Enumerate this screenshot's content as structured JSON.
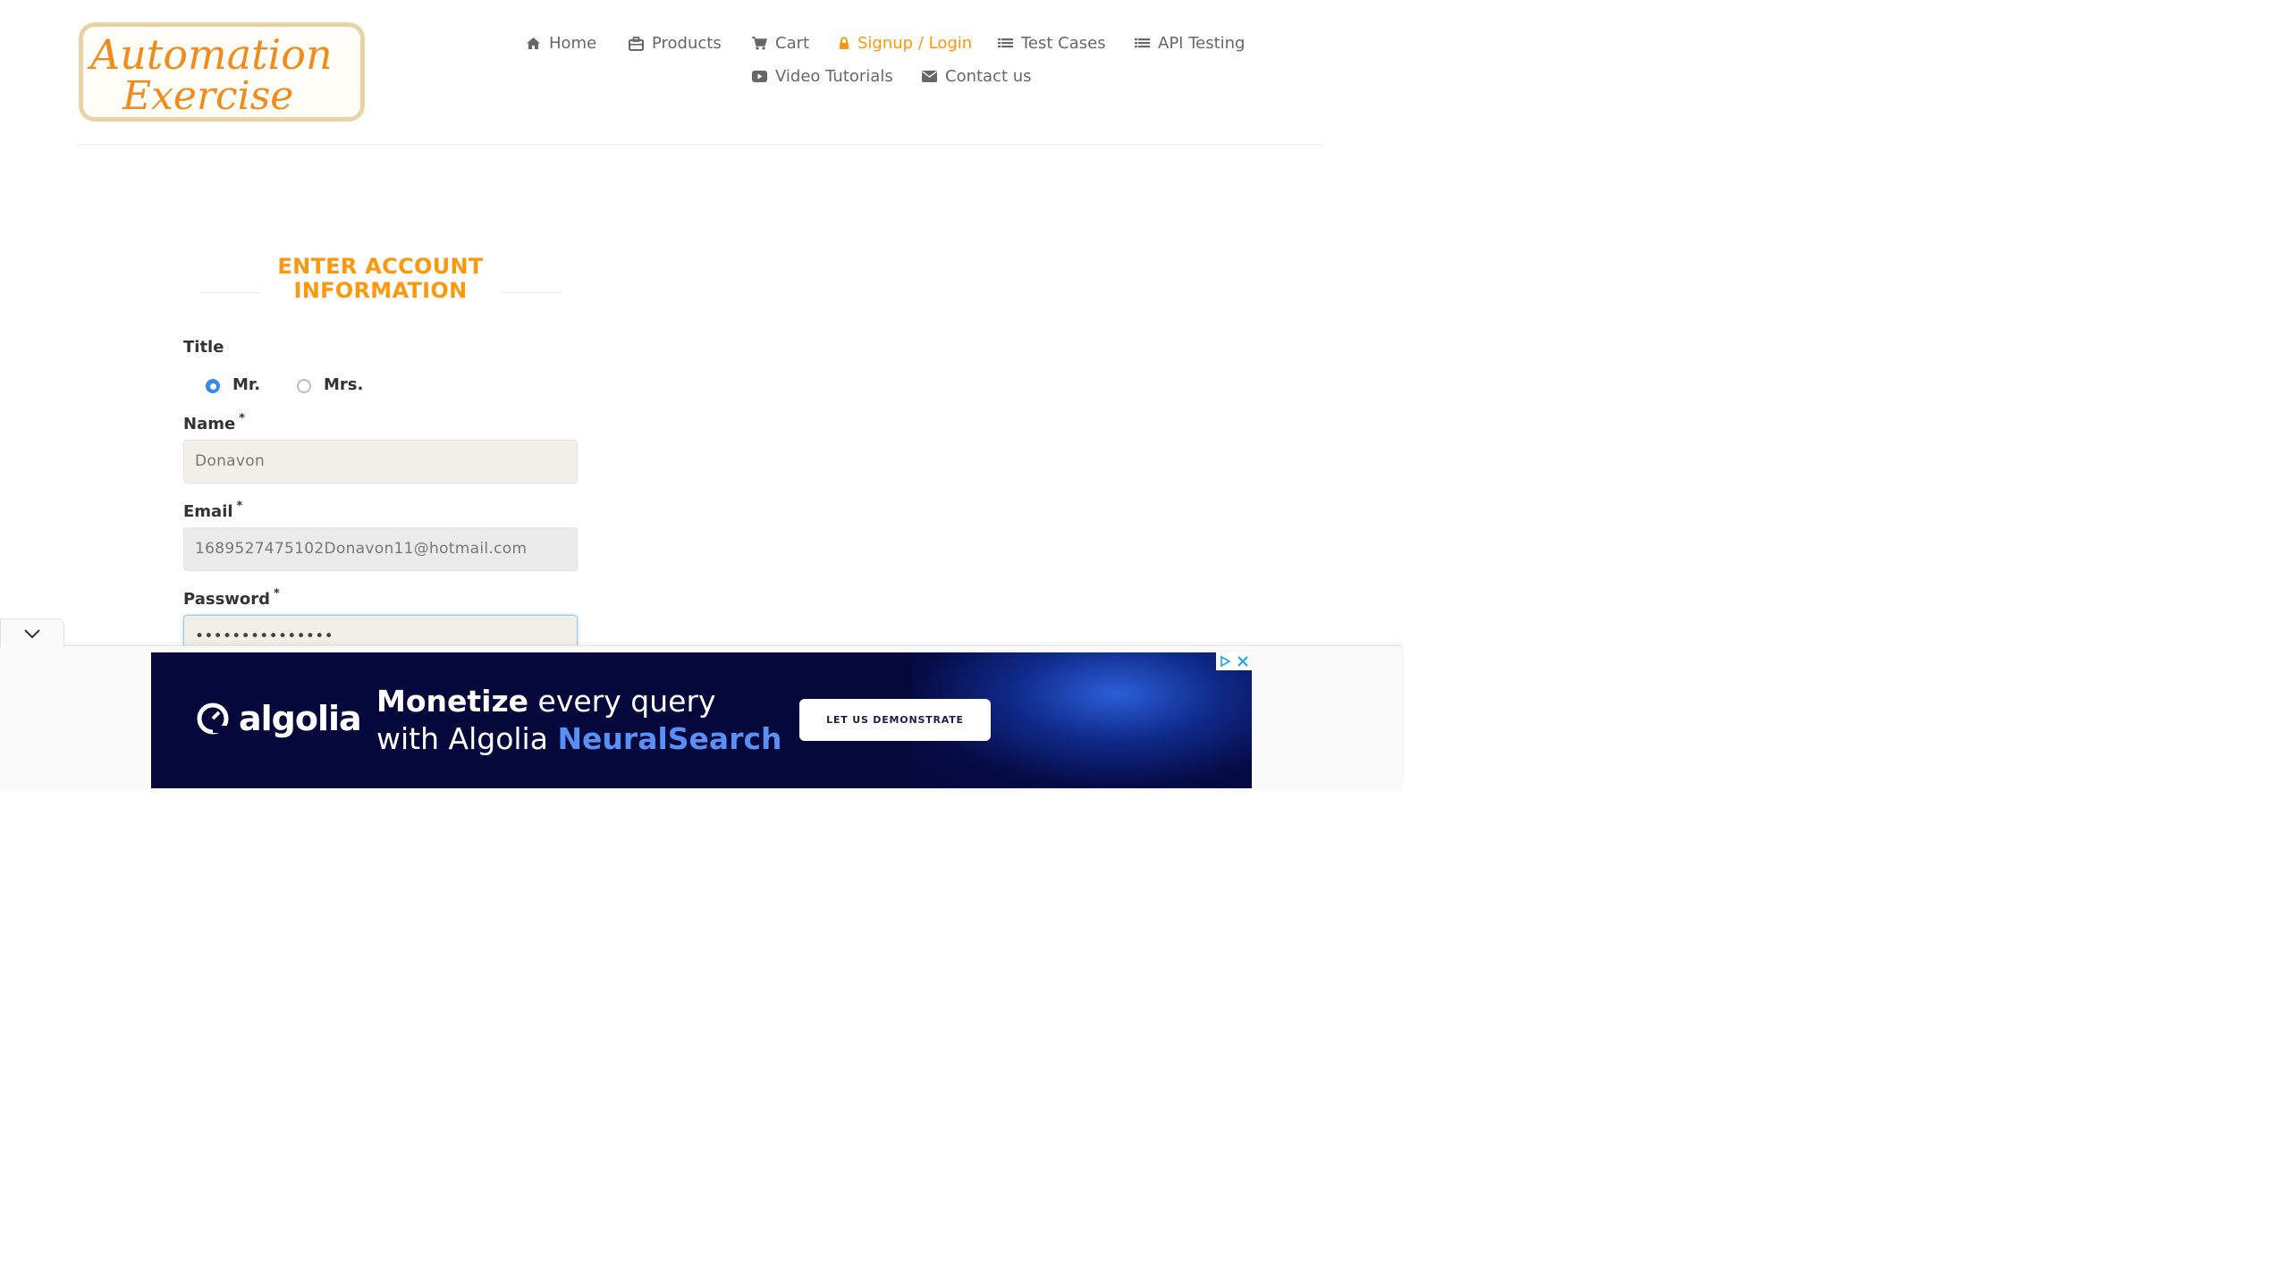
{
  "logo": {
    "alt": "Automation Exercise",
    "line1": "Automation",
    "line2": "Exercise"
  },
  "nav": {
    "items": [
      {
        "label": "Home",
        "icon": "home-icon"
      },
      {
        "label": "Products",
        "icon": "briefcase-icon"
      },
      {
        "label": "Cart",
        "icon": "cart-icon"
      },
      {
        "label": "Signup / Login",
        "icon": "lock-icon",
        "active": true
      },
      {
        "label": "Test Cases",
        "icon": "list-icon"
      },
      {
        "label": "API Testing",
        "icon": "list-icon"
      },
      {
        "label": "Video Tutorials",
        "icon": "youtube-play-icon"
      },
      {
        "label": "Contact us",
        "icon": "envelope-icon"
      }
    ]
  },
  "form": {
    "heading_line1": "ENTER ACCOUNT",
    "heading_line2": "INFORMATION",
    "title_label": "Title",
    "title_options": [
      {
        "label": "Mr.",
        "checked": true
      },
      {
        "label": "Mrs.",
        "checked": false
      }
    ],
    "name_label": "Name",
    "name_value": "Donavon",
    "email_label": "Email",
    "email_value": "1689527475102Donavon11@hotmail.com",
    "password_label": "Password",
    "password_value": "•••••••••••••••",
    "required_mark": "*"
  },
  "ad": {
    "brand": "algolia",
    "headline_bold": "Monetize",
    "headline_rest": " every query",
    "line2_prefix": "with Algolia ",
    "line2_highlight": "NeuralSearch",
    "cta": "LET US DEMONSTRATE"
  },
  "colors": {
    "accent": "#fe980f",
    "nav_text": "#696763",
    "radio_checked": "#3b86e8",
    "ad_bg": "#05083a"
  }
}
